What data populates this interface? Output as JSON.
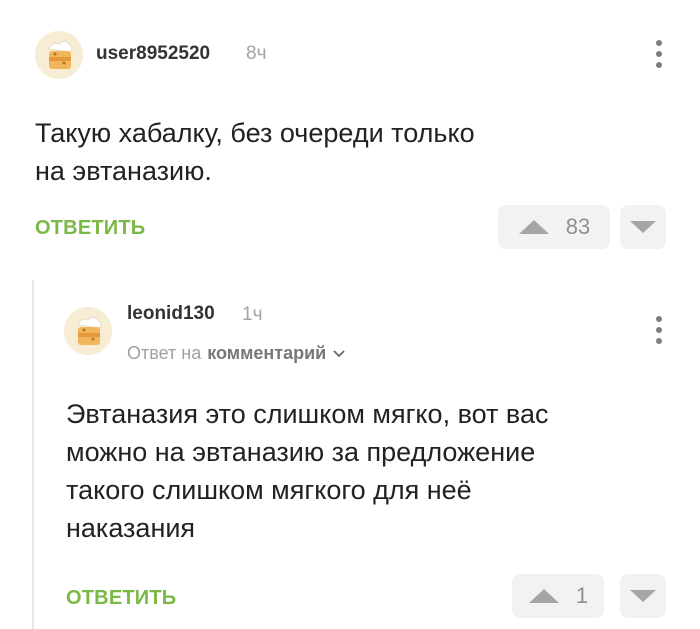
{
  "comment": {
    "username": "user8952520",
    "time": "8ч",
    "text_line1": "Такую хабалку, без очереди только",
    "text_line2": "на эвтаназию.",
    "reply_label": "ОТВЕТИТЬ",
    "votes": "83"
  },
  "reply": {
    "username": "leonid130",
    "time": "1ч",
    "reply_to_prefix": "Ответ на",
    "reply_to_link": "комментарий",
    "text_line1": "Эвтаназия это слишком мягко, вот вас",
    "text_line2": "можно на эвтаназию за предложение",
    "text_line3": "такого слишком мягкого для неё",
    "text_line4": "наказания",
    "reply_label": "ОТВЕТИТЬ",
    "votes": "1"
  },
  "colors": {
    "accent_green": "#7ab945",
    "muted_gray": "#a3a3a3",
    "vote_bg": "#f2f2f2"
  },
  "icons": [
    "avatar-cake-icon",
    "more-vert-icon",
    "upvote-arrow-icon",
    "downvote-arrow-icon",
    "chevron-down-icon"
  ]
}
